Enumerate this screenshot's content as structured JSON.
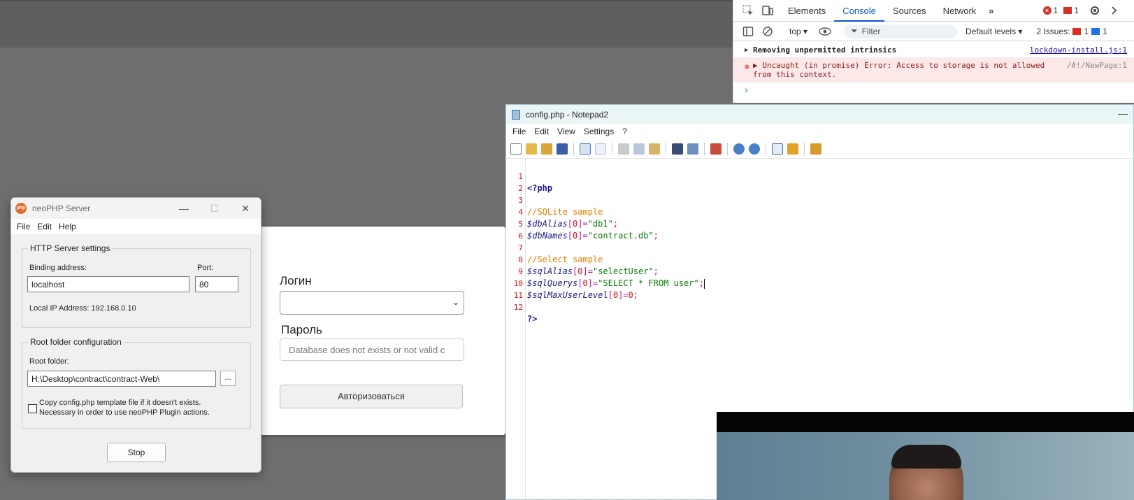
{
  "devtools": {
    "tabs": [
      "Elements",
      "Console",
      "Sources",
      "Network"
    ],
    "active_tab": "Console",
    "more_tabs": "»",
    "error_count": "1",
    "warning_count": "1",
    "context": "top",
    "filter_placeholder": "Filter",
    "levels": "Default levels",
    "issues_label": "2 Issues:",
    "issues_error_count": "1",
    "issues_info_count": "1",
    "messages": [
      {
        "text": "Removing unpermitted intrinsics",
        "source": "lockdown-install.js:1",
        "level": "info"
      },
      {
        "text": "Uncaught (in promise) Error: Access to storage is not allowed from this context.",
        "source": "/#!/NewPage:1",
        "level": "error"
      }
    ],
    "prompt": "›"
  },
  "login": {
    "login_label": "Логин",
    "password_label": "Пароль",
    "password_placeholder": "Database does not exists or not valid c",
    "submit_label": "Авторизоваться"
  },
  "neophp": {
    "title": "neoPHP Server",
    "logo_text": "php",
    "menu": [
      "File",
      "Edit",
      "Help"
    ],
    "http_group": "HTTP Server settings",
    "binding_label": "Binding address:",
    "binding_value": "localhost",
    "port_label": "Port:",
    "port_value": "80",
    "local_ip": "Local IP Address: 192.168.0.10",
    "root_group": "Root folder configuration",
    "root_label": "Root folder:",
    "root_value": "H:\\Desktop\\contract\\contract-Web\\",
    "browse_label": "...",
    "copy_checkbox_line1": "Copy config.php template file if it doesn't exists.",
    "copy_checkbox_line2": "Necessary in order to use neoPHP Plugin actions.",
    "stop_label": "Stop"
  },
  "notepad": {
    "title": "config.php - Notepad2",
    "menu": [
      "File",
      "Edit",
      "View",
      "Settings",
      "?"
    ],
    "line_numbers": [
      "1",
      "2",
      "3",
      "4",
      "5",
      "6",
      "7",
      "8",
      "9",
      "10",
      "11",
      "12"
    ]
  }
}
